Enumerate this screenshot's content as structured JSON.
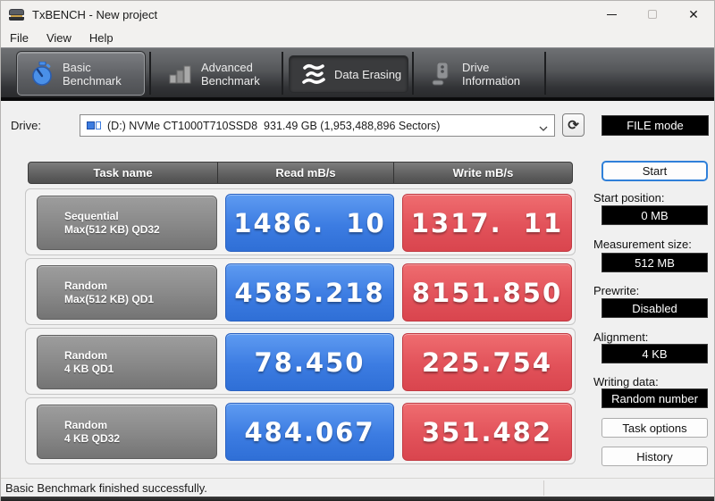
{
  "window": {
    "title": "TxBENCH - New project",
    "close_glyph": "✕"
  },
  "menu": {
    "file": "File",
    "view": "View",
    "help": "Help"
  },
  "tabs": {
    "basic": {
      "line1": "Basic",
      "line2": "Benchmark"
    },
    "advanced": {
      "line1": "Advanced",
      "line2": "Benchmark"
    },
    "erasing": {
      "line1": "Data Erasing"
    },
    "driveinfo": {
      "line1": "Drive",
      "line2": "Information"
    }
  },
  "drive": {
    "label": "Drive:",
    "value": "(D:) NVMe CT1000T710SSD8  931.49 GB (1,953,488,896 Sectors)",
    "refresh_glyph": "⟳"
  },
  "file_mode_label": "FILE mode",
  "table": {
    "headers": {
      "task": "Task name",
      "read": "Read mB/s",
      "write": "Write mB/s"
    },
    "rows": [
      {
        "task1": "Sequential",
        "task2": "Max(512 KB) QD32",
        "read": "1486.  10",
        "write": "1317.  11"
      },
      {
        "task1": "Random",
        "task2": "Max(512 KB) QD1",
        "read": "4585.218",
        "write": "8151.850"
      },
      {
        "task1": "Random",
        "task2": "4 KB QD1",
        "read": "78.450",
        "write": "225.754"
      },
      {
        "task1": "Random",
        "task2": "4 KB QD32",
        "read": "484.067",
        "write": "351.482"
      }
    ]
  },
  "sidebar": {
    "start": "Start",
    "fields": [
      {
        "label": "Start position:",
        "value": "0 MB"
      },
      {
        "label": "Measurement size:",
        "value": "512 MB"
      },
      {
        "label": "Prewrite:",
        "value": "Disabled"
      },
      {
        "label": "Alignment:",
        "value": "4 KB"
      },
      {
        "label": "Writing data:",
        "value": "Random number"
      }
    ],
    "task_options": "Task options",
    "history": "History"
  },
  "status": "Basic Benchmark finished successfully.",
  "colors": {
    "read_value_blue": "#3c7ce2",
    "write_value_red": "#e2525a",
    "stopwatch_blue": "#4a90e8",
    "start_border_blue": "#2f80d9",
    "value_box_black": "#000000"
  }
}
